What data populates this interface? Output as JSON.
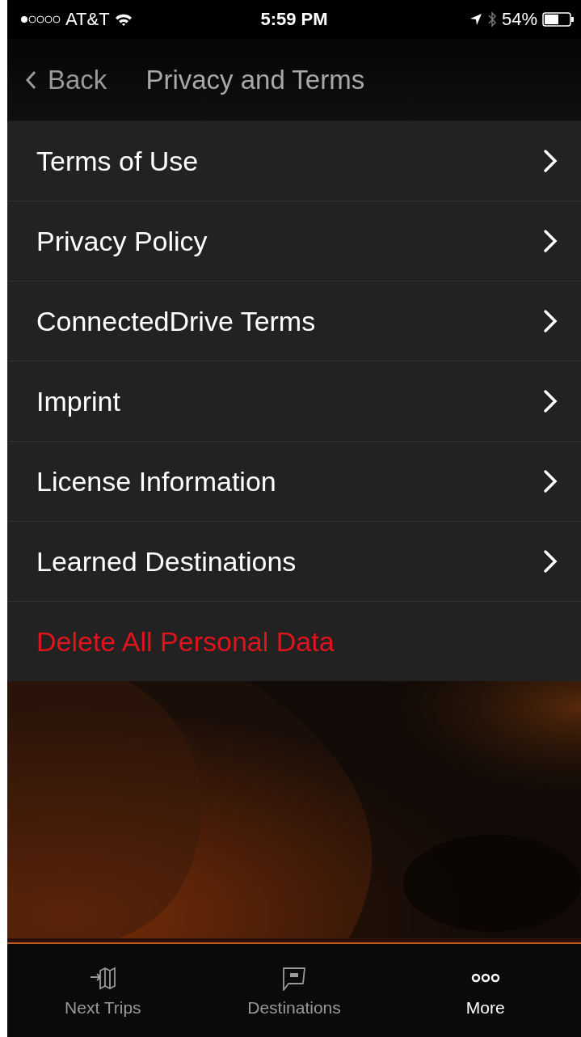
{
  "status_bar": {
    "carrier": "AT&T",
    "time": "5:59 PM",
    "battery": "54%"
  },
  "nav": {
    "back": "Back",
    "title": "Privacy and Terms"
  },
  "items": [
    {
      "label": "Terms of Use",
      "kind": "link"
    },
    {
      "label": "Privacy Policy",
      "kind": "link"
    },
    {
      "label": "ConnectedDrive Terms",
      "kind": "link"
    },
    {
      "label": "Imprint",
      "kind": "link"
    },
    {
      "label": "License Information",
      "kind": "link"
    },
    {
      "label": "Learned Destinations",
      "kind": "link"
    },
    {
      "label": "Delete All Personal Data",
      "kind": "destructive"
    }
  ],
  "tabs": [
    {
      "label": "Next Trips",
      "kind": "map",
      "selected": false
    },
    {
      "label": "Destinations",
      "kind": "chat",
      "selected": false
    },
    {
      "label": "More",
      "kind": "dots",
      "selected": true
    }
  ]
}
